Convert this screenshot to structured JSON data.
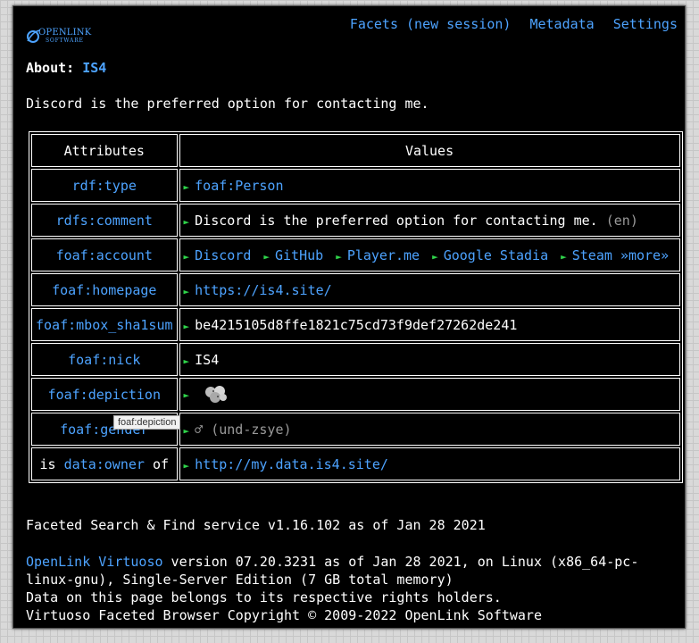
{
  "logo": {
    "line1": "OPENLINK",
    "line2": "SOFTWARE"
  },
  "nav": {
    "facets": "Facets (new session)",
    "metadata": "Metadata",
    "settings": "Settings"
  },
  "about": {
    "label": "About:",
    "entity": "IS4"
  },
  "intro": "Discord is the preferred option for contacting me.",
  "table": {
    "headers": {
      "attributes": "Attributes",
      "values": "Values"
    },
    "rows": [
      {
        "attr": "rdf:type",
        "value": "foaf:Person"
      },
      {
        "attr": "rdfs:comment",
        "value": "Discord is the preferred option for contacting me.",
        "lang": "(en)"
      },
      {
        "attr": "foaf:account",
        "values": [
          "Discord",
          "GitHub",
          "Player.me",
          "Google Stadia",
          "Steam"
        ],
        "more": "»more»"
      },
      {
        "attr": "foaf:homepage",
        "value": "https://is4.site/"
      },
      {
        "attr": "foaf:mbox_sha1sum",
        "value": "be4215105d8ffe1821c75cd73f9def27262de241"
      },
      {
        "attr": "foaf:nick",
        "value": "IS4"
      },
      {
        "attr": "foaf:depiction",
        "value": ""
      },
      {
        "attr": "foaf:gender",
        "value": "♂",
        "lang": "(und-zsye)"
      },
      {
        "attr_prefix": "is",
        "attr": "data:owner",
        "attr_suffix": "of",
        "value": "http://my.data.is4.site/"
      }
    ]
  },
  "tooltip": "foaf:depiction",
  "footer": {
    "service": "Faceted Search & Find service v1.16.102 as of Jan 28 2021",
    "virtuoso_link": "OpenLink Virtuoso",
    "version": " version 07.20.3231 as of Jan 28 2021, on Linux (x86_64-pc-linux-gnu), Single-Server Edition (7 GB total memory)",
    "rights": "Data on this page belongs to its respective rights holders.",
    "copyright": "Virtuoso Faceted Browser Copyright © 2009-2022 OpenLink Software"
  },
  "colors": {
    "link": "#4da3ff",
    "bullet": "#2fd44a",
    "background": "#000000"
  }
}
